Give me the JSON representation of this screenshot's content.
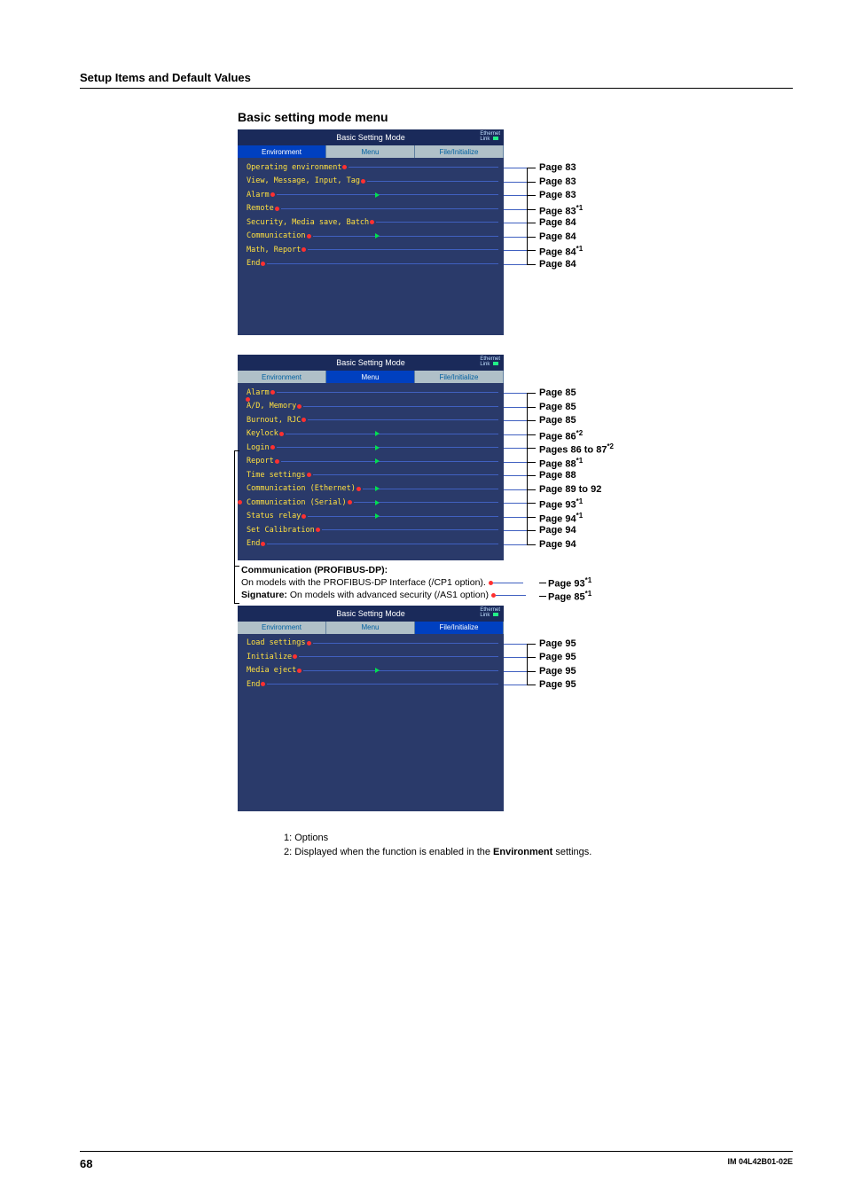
{
  "header": {
    "title": "Setup Items and Default Values"
  },
  "section_title": "Basic setting mode menu",
  "screen_title": "Basic Setting Mode",
  "eth_label": "Ethernet\nLink",
  "tabs": {
    "env": "Environment",
    "menu": "Menu",
    "file": "File/Initialize"
  },
  "panel1": {
    "items": [
      {
        "label": "Operating environment",
        "page": "Page 83",
        "arrow": false
      },
      {
        "label": "View, Message, Input, Tag",
        "page": "Page 83",
        "arrow": false
      },
      {
        "label": "Alarm",
        "page": "Page 83",
        "arrow": true
      },
      {
        "label": "Remote",
        "page": "Page 83",
        "sup": "*1",
        "arrow": false
      },
      {
        "label": "Security, Media save, Batch",
        "page": "Page 84",
        "arrow": false
      },
      {
        "label": "Communication",
        "page": "Page 84",
        "arrow": true
      },
      {
        "label": "Math, Report",
        "page": "Page 84",
        "sup": "*1",
        "arrow": false
      },
      {
        "label": "End",
        "page": "Page 84",
        "arrow": false
      }
    ]
  },
  "panel2": {
    "items": [
      {
        "label": "Alarm",
        "page": "Page 85",
        "arrow": false
      },
      {
        "label": "A/D, Memory",
        "page": "Page 85",
        "arrow": false,
        "topdot": true
      },
      {
        "label": "Burnout, RJC",
        "page": "Page 85",
        "arrow": false
      },
      {
        "label": "Keylock",
        "page": "Page 86",
        "sup": "*2",
        "arrow": true
      },
      {
        "label": "Login",
        "page": "Pages 86 to 87",
        "sup": "*2",
        "arrow": true
      },
      {
        "label": "Report",
        "page": "Page 88",
        "sup": "*1",
        "arrow": true
      },
      {
        "label": "Time settings",
        "page": "Page 88",
        "arrow": false
      },
      {
        "label": "Communication (Ethernet)",
        "page": "Page 89 to 92",
        "arrow": true
      },
      {
        "label": "Communication (Serial)",
        "page": "Page 93",
        "sup": "*1",
        "arrow": true,
        "leftdot": true
      },
      {
        "label": "Status relay",
        "page": "Page 94",
        "sup": "*1",
        "arrow": true
      },
      {
        "label": "Set Calibration",
        "page": "Page 94",
        "arrow": false
      },
      {
        "label": "End",
        "page": "Page 94",
        "arrow": false
      }
    ]
  },
  "notes": {
    "heading": "Communication (PROFIBUS-DP):",
    "line1": "On models with the PROFIBUS-DP Interface (/CP1 option).",
    "line2a": "Signature:",
    "line2b": " On models with advanced security (/AS1 option)",
    "page1": "Page 93",
    "page1sup": "*1",
    "page2": "Page 85",
    "page2sup": "*1"
  },
  "panel3": {
    "items": [
      {
        "label": "Load settings",
        "page": "Page 95",
        "arrow": false
      },
      {
        "label": "Initialize",
        "page": "Page 95",
        "arrow": false
      },
      {
        "label": "Media eject",
        "page": "Page 95",
        "arrow": true
      },
      {
        "label": "End",
        "page": "Page 95",
        "arrow": false
      }
    ]
  },
  "footnotes": {
    "f1": "1: Options",
    "f2a": "2: Displayed when the function is enabled in the ",
    "f2b": "Environment",
    "f2c": " settings."
  },
  "footer": {
    "page": "68",
    "doc": "IM 04L42B01-02E"
  }
}
